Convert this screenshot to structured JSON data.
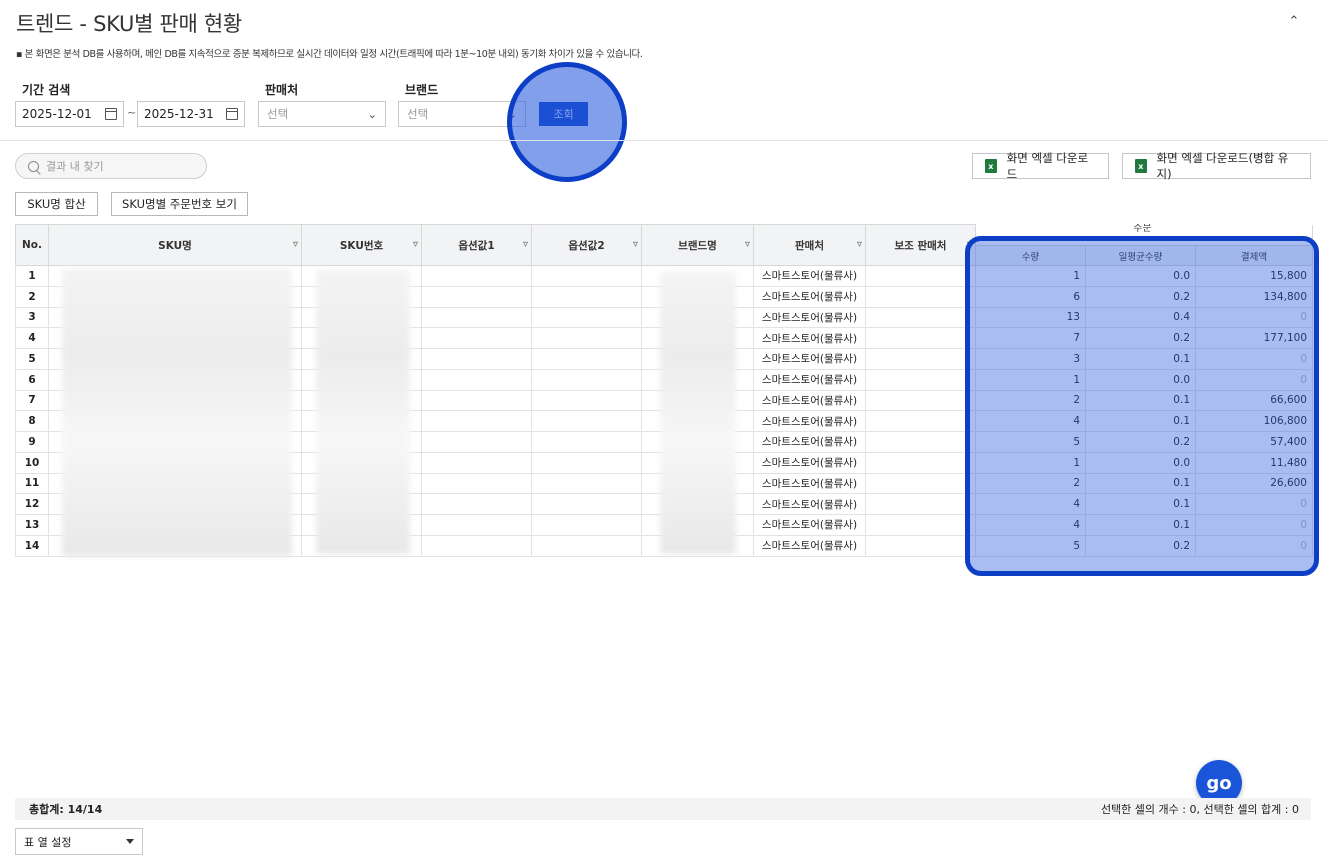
{
  "page": {
    "title": "트렌드 - SKU별 판매 현황",
    "notice": "본 화면은 분석 DB를 사용하며, 메인 DB를 지속적으로 증분 복제하므로 실시간 데이터와 일정 시간(트래픽에 따라 1분~10분 내외) 동기화 차이가 있을 수 있습니다."
  },
  "filters": {
    "period_label": "기간 검색",
    "start_date": "2025-12-01",
    "end_date": "2025-12-31",
    "tilde": "~",
    "seller_label": "판매처",
    "seller_placeholder": "선택",
    "brand_label": "브랜드",
    "brand_placeholder": "선택",
    "search_button": "조회"
  },
  "toolbar": {
    "search_placeholder": "결과 내 찾기",
    "excel_download": "화면 엑셀 다운로드",
    "excel_download_merge": "화면 엑셀 다운로드(병합 유지)",
    "sum_by_sku": "SKU명 합산",
    "order_no_by_sku": "SKU명별 주문번호 보기",
    "excel_icon": "x"
  },
  "table": {
    "group_header": "주문",
    "columns": [
      "No.",
      "SKU명",
      "SKU번호",
      "옵션값1",
      "옵션값2",
      "브랜드명",
      "판매처",
      "보조 판매처"
    ],
    "sub_columns": [
      "수량",
      "일평균수량",
      "결제액"
    ],
    "rows": [
      {
        "no": "1",
        "seller": "스마트스토어(물류사)",
        "qty": "1",
        "avg": "0.0",
        "amount": "15,800"
      },
      {
        "no": "2",
        "seller": "스마트스토어(물류사)",
        "qty": "6",
        "avg": "0.2",
        "amount": "134,800"
      },
      {
        "no": "3",
        "seller": "스마트스토어(물류사)",
        "qty": "13",
        "avg": "0.4",
        "amount": "0"
      },
      {
        "no": "4",
        "seller": "스마트스토어(물류사)",
        "qty": "7",
        "avg": "0.2",
        "amount": "177,100"
      },
      {
        "no": "5",
        "seller": "스마트스토어(물류사)",
        "qty": "3",
        "avg": "0.1",
        "amount": "0"
      },
      {
        "no": "6",
        "seller": "스마트스토어(물류사)",
        "qty": "1",
        "avg": "0.0",
        "amount": "0"
      },
      {
        "no": "7",
        "seller": "스마트스토어(물류사)",
        "qty": "2",
        "avg": "0.1",
        "amount": "66,600"
      },
      {
        "no": "8",
        "seller": "스마트스토어(물류사)",
        "qty": "4",
        "avg": "0.1",
        "amount": "106,800"
      },
      {
        "no": "9",
        "seller": "스마트스토어(물류사)",
        "qty": "5",
        "avg": "0.2",
        "amount": "57,400"
      },
      {
        "no": "10",
        "seller": "스마트스토어(물류사)",
        "qty": "1",
        "avg": "0.0",
        "amount": "11,480"
      },
      {
        "no": "11",
        "seller": "스마트스토어(물류사)",
        "qty": "2",
        "avg": "0.1",
        "amount": "26,600"
      },
      {
        "no": "12",
        "seller": "스마트스토어(물류사)",
        "qty": "4",
        "avg": "0.1",
        "amount": "0"
      },
      {
        "no": "13",
        "seller": "스마트스토어(물류사)",
        "qty": "4",
        "avg": "0.1",
        "amount": "0"
      },
      {
        "no": "14",
        "seller": "스마트스토어(물류사)",
        "qty": "5",
        "avg": "0.2",
        "amount": "0"
      }
    ]
  },
  "footer": {
    "total": "총합계: 14/14",
    "selection_summary": "선택한 셀의 개수 : 0, 선택한 셀의 합계 : 0",
    "column_settings": "표 열 설정"
  },
  "floating": {
    "go_label": "go",
    "go_icon": "go-logo-icon"
  },
  "colors": {
    "primary": "#0d43c7",
    "highlight": "#0c3fc6",
    "excel": "#1f7a3d"
  }
}
